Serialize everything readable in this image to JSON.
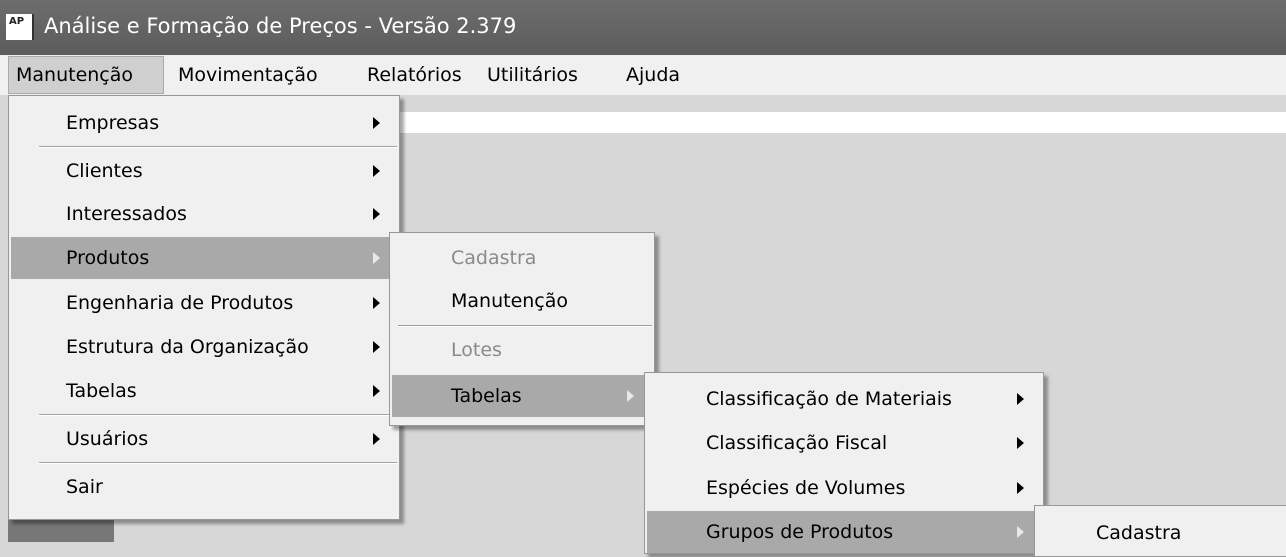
{
  "window": {
    "icon_text": "AP",
    "title": "Análise e Formação de Preços - Versão 2.379"
  },
  "menubar": {
    "items": [
      {
        "label": "Manutenção"
      },
      {
        "label": "Movimentação"
      },
      {
        "label": "Relatórios"
      },
      {
        "label": "Utilitários"
      },
      {
        "label": "Ajuda"
      }
    ]
  },
  "menu_manutencao": {
    "items": [
      {
        "label": "Empresas"
      },
      {
        "label": "Clientes"
      },
      {
        "label": "Interessados"
      },
      {
        "label": "Produtos"
      },
      {
        "label": "Engenharia de Produtos"
      },
      {
        "label": "Estrutura da Organização"
      },
      {
        "label": "Tabelas"
      },
      {
        "label": "Usuários"
      },
      {
        "label": "Sair"
      }
    ]
  },
  "menu_produtos": {
    "items": [
      {
        "label": "Cadastra",
        "disabled": true
      },
      {
        "label": "Manutenção"
      },
      {
        "label": "Lotes",
        "disabled": true
      },
      {
        "label": "Tabelas"
      }
    ]
  },
  "menu_tabelas": {
    "items": [
      {
        "label": "Classificação de Materiais"
      },
      {
        "label": "Classificação Fiscal"
      },
      {
        "label": "Espécies de Volumes"
      },
      {
        "label": "Grupos de Produtos"
      }
    ]
  },
  "menu_grupos": {
    "items": [
      {
        "label": "Cadastra"
      }
    ]
  }
}
